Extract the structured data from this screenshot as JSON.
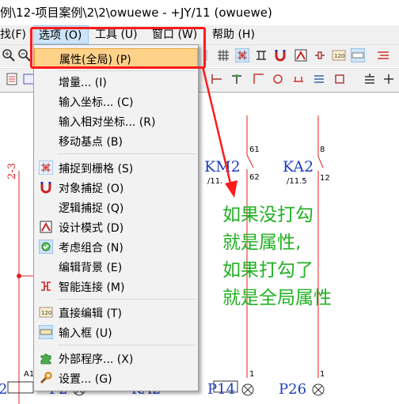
{
  "title": "例\\12-项目案例\\2\\2\\owuewe - +JY/11 (owuewe)",
  "menubar": {
    "items": [
      {
        "label": "找(F)"
      },
      {
        "label": "选项 (O)"
      },
      {
        "label": "工具 (U)"
      },
      {
        "label": "窗口 (W)"
      },
      {
        "label": "帮助 (H)"
      }
    ]
  },
  "dropdown": {
    "items": [
      {
        "label": "属性(全局) (P)",
        "icon": "none",
        "highlighted": true
      },
      {
        "label": "增量... (I)",
        "icon": "none"
      },
      {
        "label": "输入坐标... (C)",
        "icon": "none"
      },
      {
        "label": "输入相对坐标... (R)",
        "icon": "none"
      },
      {
        "label": "移动基点 (B)",
        "icon": "none"
      },
      {
        "label": "捕捉到栅格 (S)",
        "icon": "grid-snap-icon"
      },
      {
        "label": "对象捕捉 (O)",
        "icon": "magnet-icon"
      },
      {
        "label": "逻辑捕捉 (Q)",
        "icon": "none"
      },
      {
        "label": "设计模式 (D)",
        "icon": "design-mode-icon"
      },
      {
        "label": "考虑组合 (N)",
        "icon": "group-icon"
      },
      {
        "label": "编辑背景 (E)",
        "icon": "none"
      },
      {
        "label": "智能连接 (M)",
        "icon": "smart-connect-icon"
      },
      {
        "label": "直接编辑 (T)",
        "icon": "direct-edit-icon"
      },
      {
        "label": "输入框 (U)",
        "icon": "input-box-icon"
      },
      {
        "label": "外部程序... (X)",
        "icon": "puzzle-icon"
      },
      {
        "label": "设置... (G)",
        "icon": "wrench-icon"
      }
    ]
  },
  "annotation": {
    "lines": [
      "如果没打勾",
      "就是属性,",
      "如果打勾了",
      "就是全局属性"
    ],
    "color": "#22b022"
  },
  "schematic": {
    "labels": {
      "ref_23": "2-3",
      "km2": "KM2",
      "km2_ref": "/11.",
      "ka2": "KA2",
      "ka2_ref": "/11.5",
      "n61": "61",
      "n62": "62",
      "n8": "8",
      "n12": "12",
      "a1": "A1",
      "n1a": "1",
      "n1b": "1",
      "p2a": "2",
      "p2": "P2",
      "ka2b": "KA2",
      "p14": "P14",
      "p26": "P26"
    }
  },
  "colors": {
    "accent_red": "#ff1a1a",
    "highlight": "#ffd28a",
    "schematic_blue": "#1f3fbf"
  }
}
